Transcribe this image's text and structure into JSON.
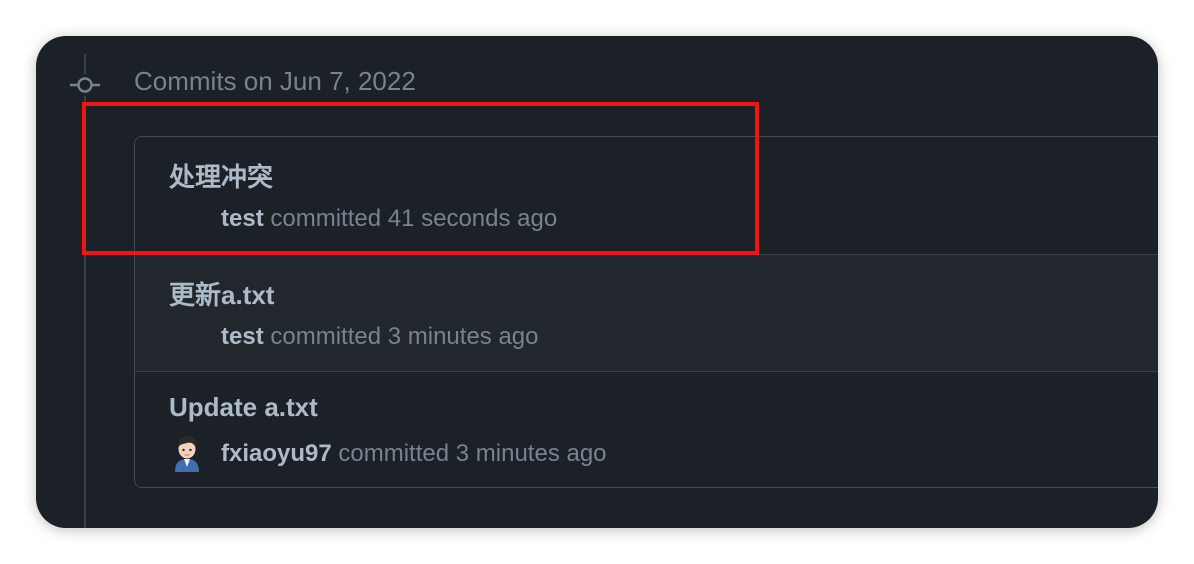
{
  "timeline": {
    "date_heading": "Commits on Jun 7, 2022"
  },
  "commits": [
    {
      "title": "处理冲突",
      "author": "test",
      "action": "committed",
      "time": "41 seconds ago"
    },
    {
      "title": "更新a.txt",
      "author": "test",
      "action": "committed",
      "time": "3 minutes ago"
    },
    {
      "title": "Update a.txt",
      "author": "fxiaoyu97",
      "action": "committed",
      "time": "3 minutes ago",
      "avatar_icon": "user-avatar"
    }
  ],
  "colors": {
    "background": "#1c2128",
    "alt_row": "#22272e",
    "border": "#444c56",
    "text_primary": "#adbac7",
    "text_muted": "#768390",
    "highlight": "#f01414"
  }
}
